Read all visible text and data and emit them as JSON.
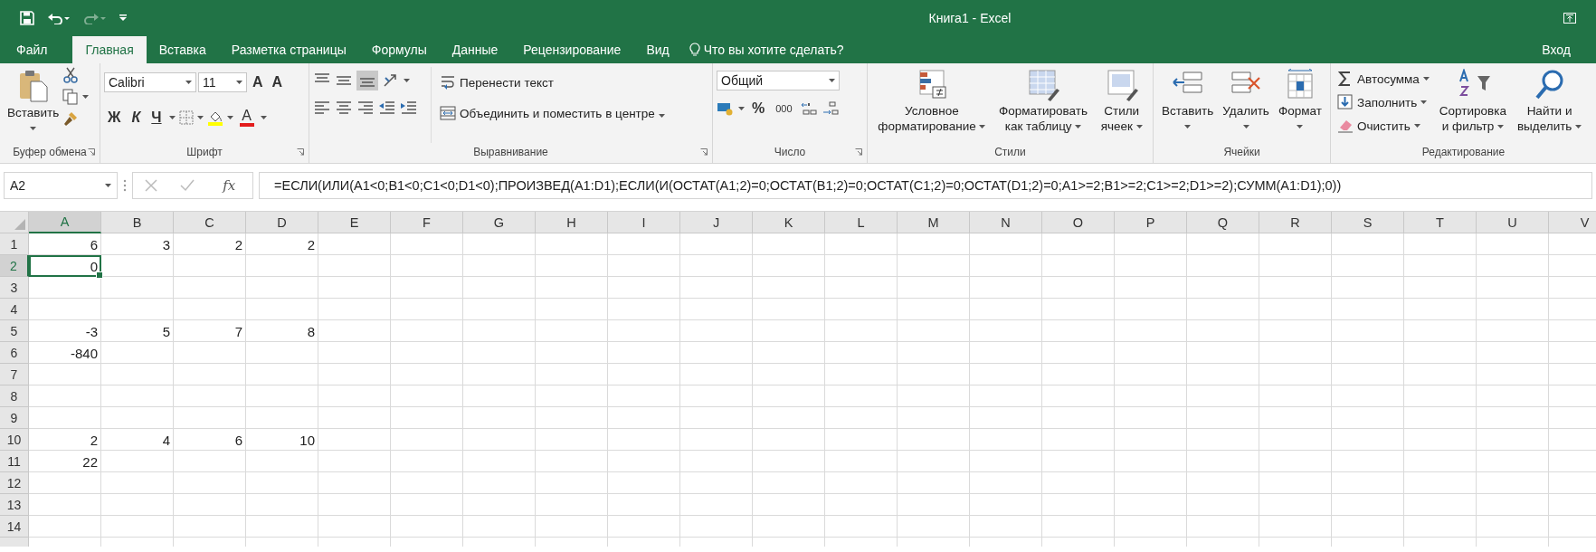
{
  "window": {
    "title": "Книга1 - Excel"
  },
  "tabs": [
    {
      "label": "Файл",
      "selected": false
    },
    {
      "label": "Главная",
      "selected": true
    },
    {
      "label": "Вставка",
      "selected": false
    },
    {
      "label": "Разметка страницы",
      "selected": false
    },
    {
      "label": "Формулы",
      "selected": false
    },
    {
      "label": "Данные",
      "selected": false
    },
    {
      "label": "Рецензирование",
      "selected": false
    },
    {
      "label": "Вид",
      "selected": false
    }
  ],
  "tell_me": {
    "placeholder": "Что вы хотите сделать?"
  },
  "sign_in": "Вход",
  "ribbon": {
    "clipboard": {
      "paste": "Вставить",
      "group_label": "Буфер обмена"
    },
    "font": {
      "font_name": "Calibri",
      "font_size": "11",
      "grow": "A",
      "shrink": "A",
      "bold": "Ж",
      "italic": "К",
      "underline": "Ч",
      "font_color": "A",
      "group_label": "Шрифт"
    },
    "alignment": {
      "wrap_text": "Перенести текст",
      "merge_center": "Объединить и поместить в центре",
      "group_label": "Выравнивание"
    },
    "number": {
      "format": "Общий",
      "percent": "%",
      "thousands": "000",
      "group_label": "Число"
    },
    "styles": {
      "buttons": [
        {
          "kind": "conditional",
          "label": "Условное\nформатирование"
        },
        {
          "kind": "table",
          "label": "Форматировать\nкак таблицу"
        },
        {
          "kind": "cellstyles",
          "label": "Стили\nячеек"
        }
      ],
      "group_label": "Стили"
    },
    "cells": {
      "buttons": [
        {
          "kind": "insert",
          "label": "Вставить"
        },
        {
          "kind": "delete",
          "label": "Удалить"
        },
        {
          "kind": "format",
          "label": "Формат"
        }
      ],
      "group_label": "Ячейки"
    },
    "editing": {
      "items": [
        {
          "kind": "sum",
          "label": "Автосумма"
        },
        {
          "kind": "fill",
          "label": "Заполнить"
        },
        {
          "kind": "clear",
          "label": "Очистить"
        }
      ],
      "buttons": [
        {
          "kind": "sort",
          "label": "Сортировка\nи фильтр"
        },
        {
          "kind": "find",
          "label": "Найти и\nвыделить"
        }
      ],
      "group_label": "Редактирование"
    }
  },
  "formula_bar": {
    "name_box": "A2",
    "fx": "fx",
    "formula": "=ЕСЛИ(ИЛИ(A1<0;B1<0;C1<0;D1<0);ПРОИЗВЕД(A1:D1);ЕСЛИ(И(ОСТАТ(A1;2)=0;ОСТАТ(B1;2)=0;ОСТАТ(C1;2)=0;ОСТАТ(D1;2)=0;A1>=2;B1>=2;C1>=2;D1>=2);СУММ(A1:D1);0))"
  },
  "sheet": {
    "columns": [
      {
        "label": "A",
        "selected": true
      },
      {
        "label": "B",
        "selected": false
      },
      {
        "label": "C",
        "selected": false
      },
      {
        "label": "D",
        "selected": false
      },
      {
        "label": "E",
        "selected": false
      },
      {
        "label": "F",
        "selected": false
      },
      {
        "label": "G",
        "selected": false
      },
      {
        "label": "H",
        "selected": false
      },
      {
        "label": "I",
        "selected": false
      },
      {
        "label": "J",
        "selected": false
      },
      {
        "label": "K",
        "selected": false
      },
      {
        "label": "L",
        "selected": false
      },
      {
        "label": "M",
        "selected": false
      },
      {
        "label": "N",
        "selected": false
      },
      {
        "label": "O",
        "selected": false
      },
      {
        "label": "P",
        "selected": false
      },
      {
        "label": "Q",
        "selected": false
      },
      {
        "label": "R",
        "selected": false
      },
      {
        "label": "S",
        "selected": false
      },
      {
        "label": "T",
        "selected": false
      },
      {
        "label": "U",
        "selected": false
      },
      {
        "label": "V",
        "selected": false
      }
    ],
    "rows": [
      {
        "label": "1",
        "selected": false,
        "cells": [
          {
            "value": "6",
            "selected": false
          },
          {
            "value": "3",
            "selected": false
          },
          {
            "value": "2",
            "selected": false
          },
          {
            "value": "2",
            "selected": false
          }
        ]
      },
      {
        "label": "2",
        "selected": true,
        "cells": [
          {
            "value": "0",
            "selected": true
          }
        ]
      },
      {
        "label": "3",
        "selected": false
      },
      {
        "label": "4",
        "selected": false
      },
      {
        "label": "5",
        "selected": false,
        "cells": [
          {
            "value": "-3",
            "selected": false
          },
          {
            "value": "5",
            "selected": false
          },
          {
            "value": "7",
            "selected": false
          },
          {
            "value": "8",
            "selected": false
          }
        ]
      },
      {
        "label": "6",
        "selected": false,
        "cells": [
          {
            "value": "-840",
            "selected": false
          }
        ]
      },
      {
        "label": "7",
        "selected": false
      },
      {
        "label": "8",
        "selected": false
      },
      {
        "label": "9",
        "selected": false
      },
      {
        "label": "10",
        "selected": false,
        "cells": [
          {
            "value": "2",
            "selected": false
          },
          {
            "value": "4",
            "selected": false
          },
          {
            "value": "6",
            "selected": false
          },
          {
            "value": "10",
            "selected": false
          }
        ]
      },
      {
        "label": "11",
        "selected": false,
        "cells": [
          {
            "value": "22",
            "selected": false
          }
        ]
      },
      {
        "label": "12",
        "selected": false
      },
      {
        "label": "13",
        "selected": false
      },
      {
        "label": "14",
        "selected": false
      }
    ]
  }
}
